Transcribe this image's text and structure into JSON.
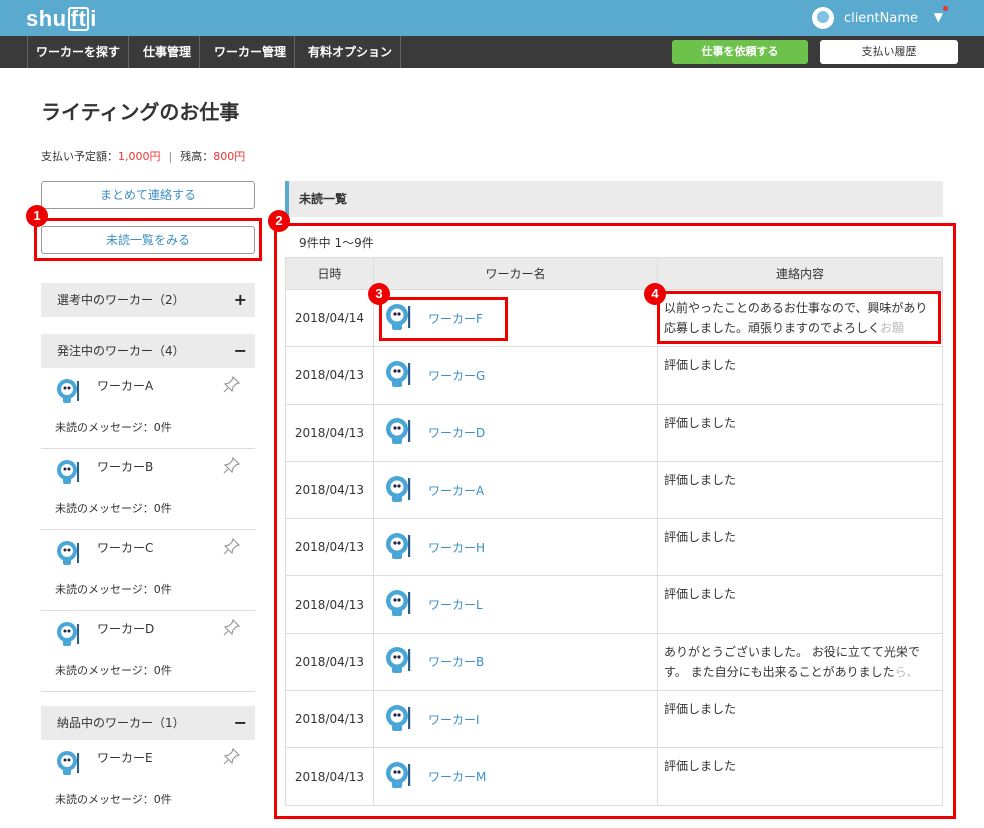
{
  "header": {
    "logo": "shufti",
    "username": "clientName",
    "nav": [
      "ワーカーを探す",
      "仕事管理",
      "ワーカー管理",
      "有料オプション"
    ],
    "request_button": "仕事を依頼する",
    "history_button": "支払い履歴"
  },
  "page": {
    "title": "ライティングのお仕事",
    "scheduled_label": "支払い予定額：",
    "scheduled_value": "1,000円",
    "balance_label": "残高：",
    "balance_value": "800円"
  },
  "sidebar": {
    "contact_all_button": "まとめて連絡する",
    "unread_button": "未読一覧をみる",
    "sections": [
      {
        "label": "選考中のワーカー（2）",
        "sign": "+"
      },
      {
        "label": "発注中のワーカー（4）",
        "sign": "−"
      },
      {
        "label": "納品中のワーカー（1）",
        "sign": "−"
      }
    ],
    "workers": [
      {
        "name": "ワーカーA",
        "msg": "未読のメッセージ：0件"
      },
      {
        "name": "ワーカーB",
        "msg": "未読のメッセージ：0件"
      },
      {
        "name": "ワーカーC",
        "msg": "未読のメッセージ：0件"
      },
      {
        "name": "ワーカーD",
        "msg": "未読のメッセージ：0件"
      },
      {
        "name": "ワーカーE",
        "msg": "未読のメッセージ：0件"
      }
    ]
  },
  "main": {
    "heading": "未読一覧",
    "count": "9件中 1〜9件",
    "columns": [
      "日時",
      "ワーカー名",
      "連絡内容"
    ],
    "rows": [
      {
        "date": "2018/04/14",
        "worker": "ワーカーF",
        "content": "以前やったことのあるお仕事なので、興味があり応募しました。頑張りますのでよろしく",
        "content_fade": "お願"
      },
      {
        "date": "2018/04/13",
        "worker": "ワーカーG",
        "content": "評価しました",
        "content_fade": ""
      },
      {
        "date": "2018/04/13",
        "worker": "ワーカーD",
        "content": "評価しました",
        "content_fade": ""
      },
      {
        "date": "2018/04/13",
        "worker": "ワーカーA",
        "content": "評価しました",
        "content_fade": ""
      },
      {
        "date": "2018/04/13",
        "worker": "ワーカーH",
        "content": "評価しました",
        "content_fade": ""
      },
      {
        "date": "2018/04/13",
        "worker": "ワーカーL",
        "content": "評価しました",
        "content_fade": ""
      },
      {
        "date": "2018/04/13",
        "worker": "ワーカーB",
        "content": "ありがとうございました。 お役に立てて光栄です。 また自分にも出来ることがありました",
        "content_fade": "ら、"
      },
      {
        "date": "2018/04/13",
        "worker": "ワーカーI",
        "content": "評価しました",
        "content_fade": ""
      },
      {
        "date": "2018/04/13",
        "worker": "ワーカーM",
        "content": "評価しました",
        "content_fade": ""
      }
    ]
  },
  "annotations": [
    "1",
    "2",
    "3",
    "4"
  ],
  "colors": {
    "accent": "#5aaad0",
    "nav": "#3a3a3a",
    "green": "#6cc24a",
    "alert": "#e00000",
    "link": "#3b8fc6"
  }
}
